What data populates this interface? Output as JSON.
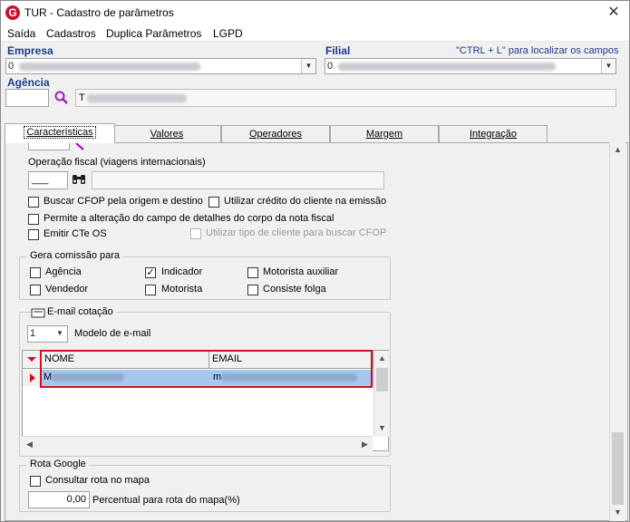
{
  "window": {
    "title": "TUR - Cadastro de parâmetros",
    "app_icon_letter": "G",
    "close_glyph": "✕"
  },
  "menu": [
    "Saída",
    "Cadastros",
    "Duplica Parâmetros",
    "LGPD"
  ],
  "header": {
    "empresa_label": "Empresa",
    "empresa_value": "0",
    "filial_label": "Filial",
    "filial_value": "0",
    "hint": "\"CTRL + L\" para localizar os campos",
    "agencia_label": "Agência",
    "agencia_value": "T"
  },
  "tabs": [
    "Características",
    "Valores",
    "Operadores",
    "Margem",
    "Integração"
  ],
  "fiscal": {
    "label": "Operação fiscal (viagens internacionais)",
    "code_value": "___"
  },
  "options": {
    "buscar_cfop": "Buscar CFOP pela origem e destino",
    "utilizar_credito": "Utilizar crédito do cliente na emissão",
    "permite_alteracao": "Permite a alteração do campo de detalhes do corpo da nota fiscal",
    "emitir_cte": "Emitir CTe OS",
    "utilizar_tipo": "Utilizar tipo de cliente para buscar CFOP"
  },
  "comissao": {
    "title": "Gera comissão para",
    "items": [
      {
        "label": "Agência",
        "checked": false
      },
      {
        "label": "Indicador",
        "checked": true
      },
      {
        "label": "Motorista auxiliar",
        "checked": false
      },
      {
        "label": "Vendedor",
        "checked": false
      },
      {
        "label": "Motorista",
        "checked": false
      },
      {
        "label": "Consiste folga",
        "checked": false
      }
    ]
  },
  "email": {
    "title": "E-mail cotação",
    "modelo_value": "1",
    "modelo_label": "Modelo de e-mail",
    "columns": [
      "NOME",
      "EMAIL"
    ],
    "row": {
      "nome": "M",
      "email": "m"
    }
  },
  "rota": {
    "title": "Rota Google",
    "consultar_label": "Consultar rota no mapa",
    "percentual_value": "0,00",
    "percentual_label": "Percentual para rota do mapa(%)"
  },
  "colors": {
    "accent_label": "#1f3a8a",
    "highlight_border": "#d4101a",
    "selected_row": "#a6c8f0"
  }
}
